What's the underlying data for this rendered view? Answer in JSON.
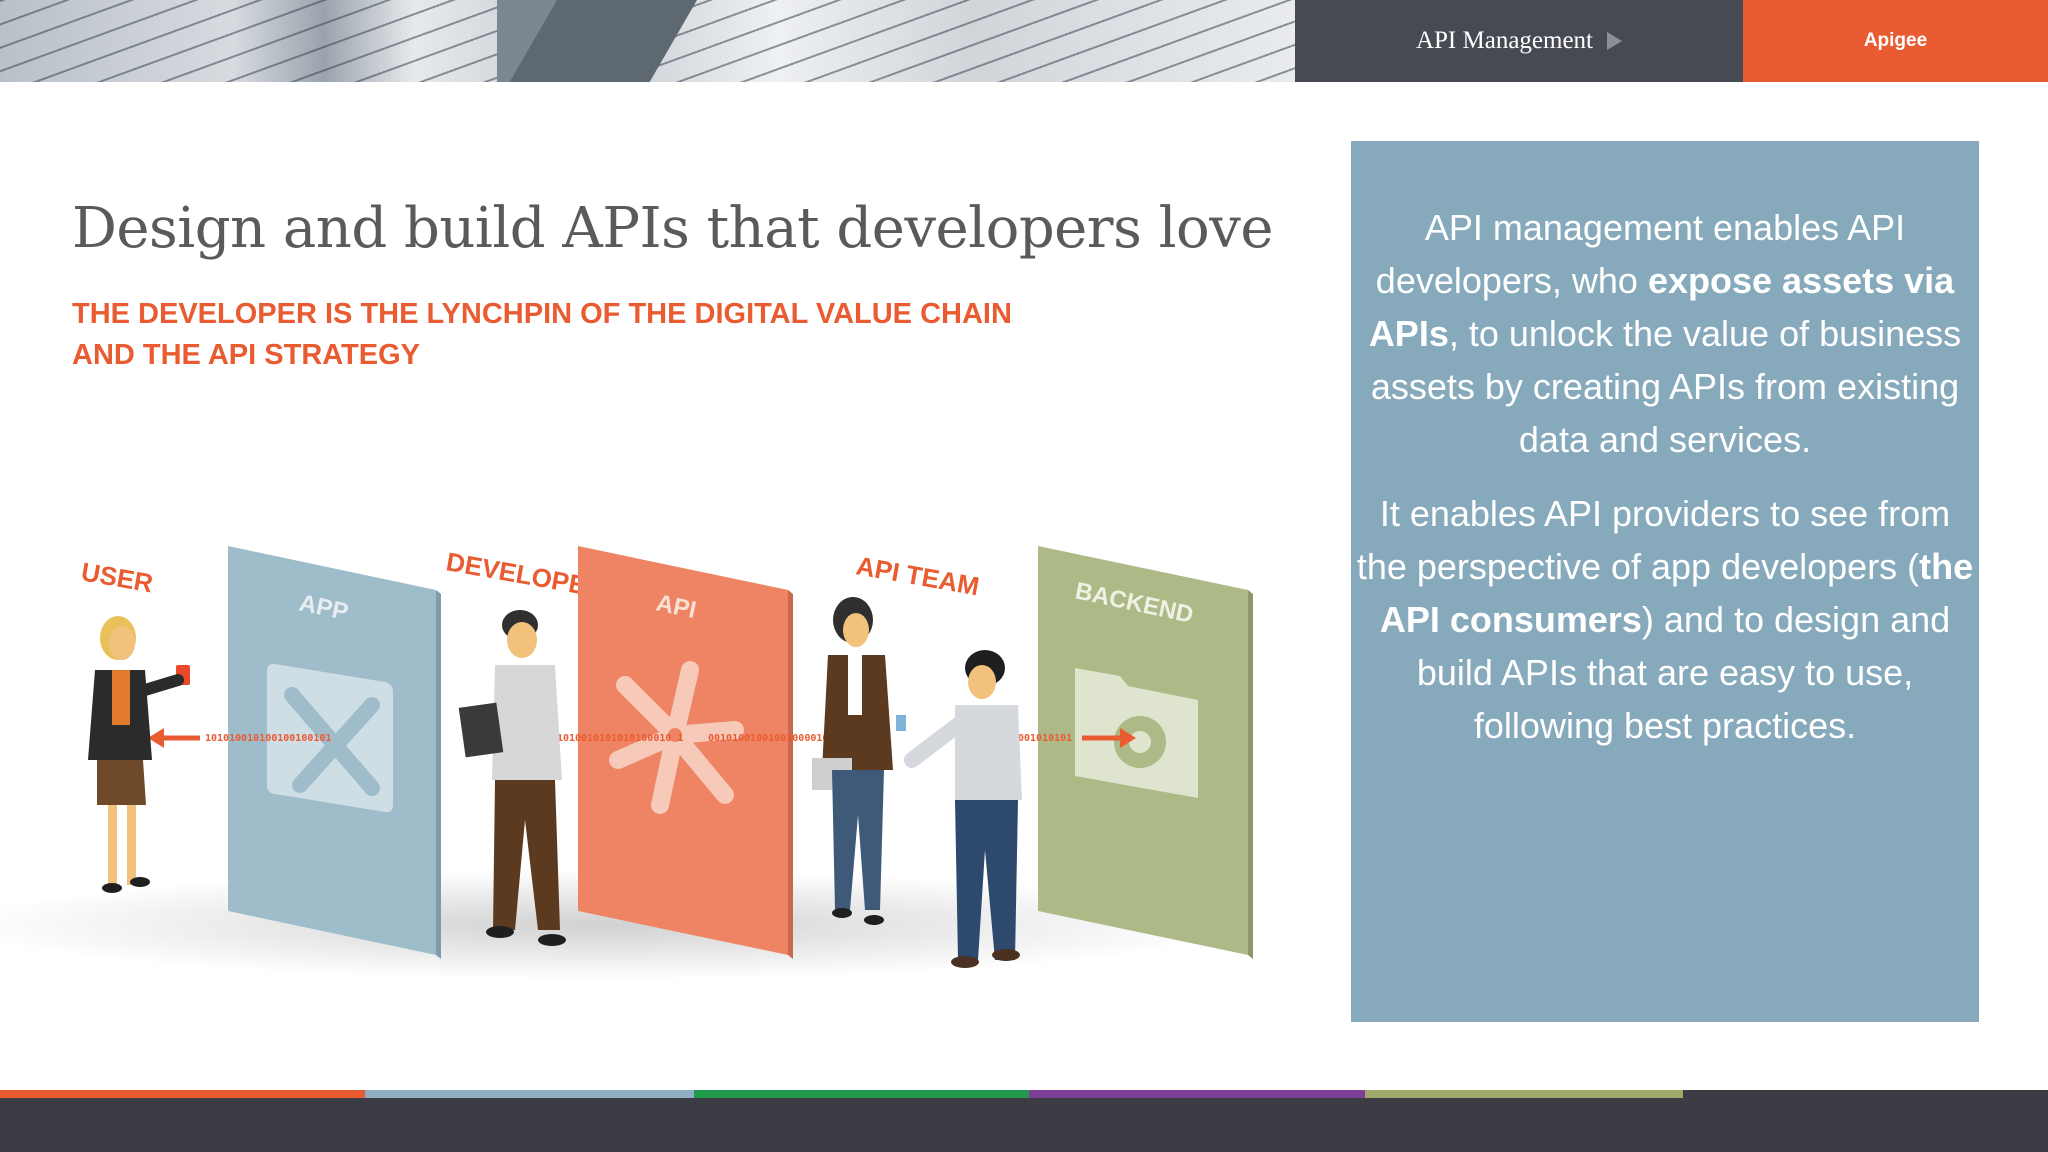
{
  "header": {
    "section_label": "API Management",
    "brand_label": "Apigee",
    "colors": {
      "dark": "#474a53",
      "accent": "#e95b31"
    }
  },
  "title": "Design and build APIs that developers love",
  "subtitle": {
    "line1": "THE DEVELOPER IS THE LYNCHPIN OF THE DIGITAL VALUE CHAIN",
    "line2": "AND THE API STRATEGY"
  },
  "illustration": {
    "labels": {
      "user": "USER",
      "app": "APP",
      "developer": "DEVELOPER",
      "api": "API",
      "api_team": "API TEAM",
      "backend": "BACKEND"
    },
    "binary": {
      "seg1": "101010010100100100101",
      "seg2": "1010010101010100010 1",
      "seg3": "0010100100100100001010",
      "seg4": "001010101"
    },
    "panel_colors": {
      "app": "#9fbccb",
      "api": "#ee8463",
      "backend": "#adb986"
    }
  },
  "info": {
    "p1_a": "API management enables API developers, who ",
    "p1_bold": "expose assets via APIs",
    "p1_b": ", to unlock the value of business assets by creating APIs from existing data and services.",
    "p2_a": "It enables API providers to see from the perspective of app developers (",
    "p2_bold": "the API consumers",
    "p2_b": ") and to design and build APIs that are easy to use, following best practices."
  },
  "bottom_stripe_colors": [
    "#e95b31",
    "#8fb0c3",
    "#1e9a4a",
    "#7b3f98",
    "#9fa86a",
    "#3b3c44"
  ]
}
